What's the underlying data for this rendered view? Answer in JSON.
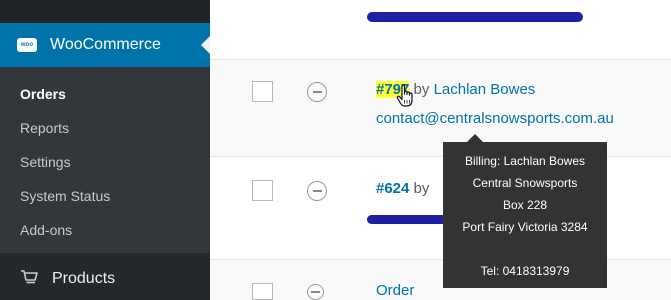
{
  "sidebar": {
    "active_menu": {
      "label": "WooCommerce",
      "icon": "woocommerce-logo-icon",
      "logo_text": "woo"
    },
    "submenu": [
      {
        "label": "Orders",
        "current": true
      },
      {
        "label": "Reports"
      },
      {
        "label": "Settings"
      },
      {
        "label": "System Status"
      },
      {
        "label": "Add-ons"
      }
    ],
    "products": {
      "label": "Products",
      "icon": "cart-icon"
    }
  },
  "orders": [
    {
      "number": "#797",
      "by": "by",
      "customer": "Lachlan Bowes",
      "email": "contact@centralsnowsports.com.au",
      "highlight_color": "#ffff33"
    },
    {
      "number": "#624",
      "by": "by"
    }
  ],
  "bottom_row": {
    "link": "Order"
  },
  "tooltip": {
    "lines": [
      "Billing: Lachlan Bowes",
      "Central Snowsports",
      "Box 228",
      "Port Fairy Victoria 3284"
    ],
    "tel": "Tel: 0418313979"
  },
  "colors": {
    "sidebar_bg": "#23282d",
    "submenu_bg": "#32373c",
    "active_bg": "#0073aa",
    "link": "#0073aa",
    "tooltip_bg": "#333333",
    "redaction": "#1f1fa3"
  }
}
